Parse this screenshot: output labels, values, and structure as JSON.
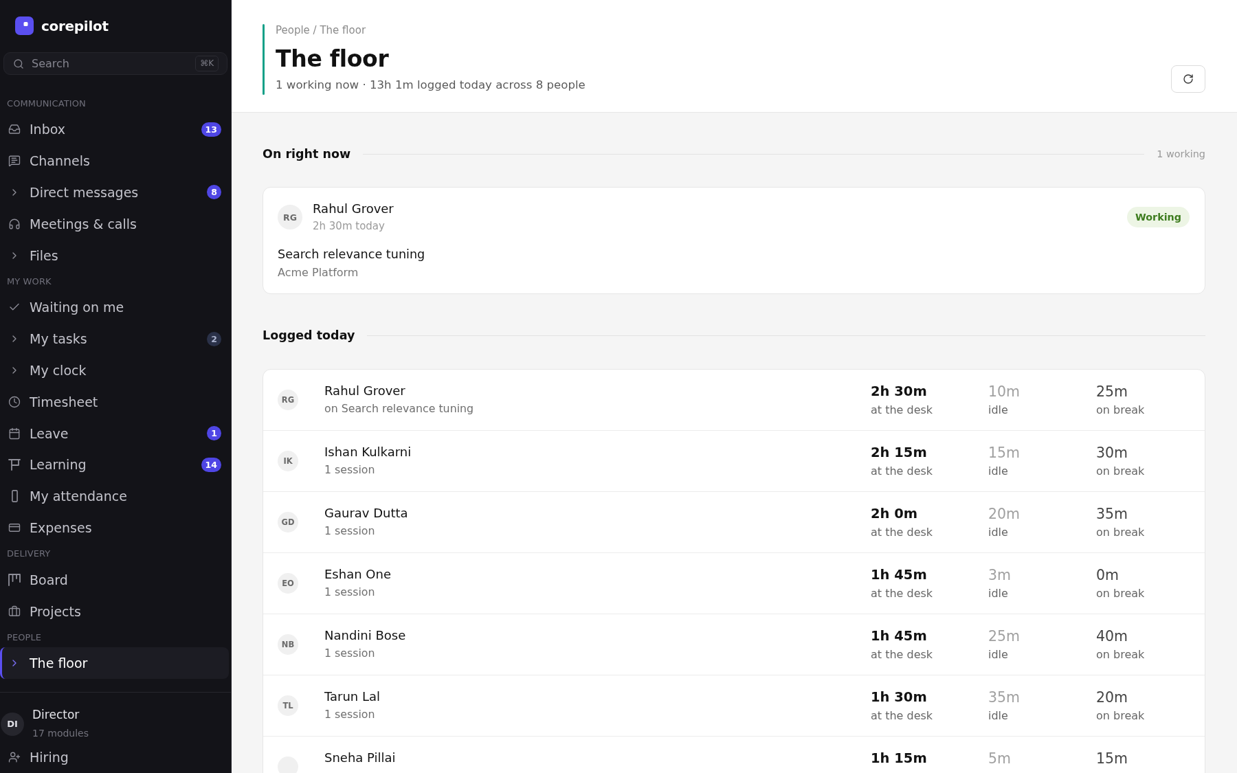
{
  "sidebar": {
    "brand": "corepilot",
    "search": {
      "placeholder": "Search",
      "shortcut": "⌘K"
    },
    "sections": [
      {
        "heading": "COMMUNICATION",
        "items": [
          {
            "label": "Inbox",
            "kind": "link",
            "selected": false,
            "badge": {
              "text": "13",
              "highlight": true
            }
          },
          {
            "label": "Channels",
            "kind": "link",
            "selected": false
          },
          {
            "label": "Direct messages",
            "kind": "group",
            "expanded": false,
            "selected": false,
            "badge": {
              "text": "8",
              "highlight": true
            }
          },
          {
            "label": "Meetings & calls",
            "kind": "link",
            "selected": false
          },
          {
            "label": "Files",
            "kind": "group",
            "expanded": false,
            "selected": false
          }
        ]
      },
      {
        "heading": "MY WORK",
        "items": [
          {
            "label": "Waiting on me",
            "kind": "link",
            "selected": false
          },
          {
            "label": "My tasks",
            "kind": "group",
            "expanded": false,
            "selected": false,
            "badge": {
              "text": "2",
              "highlight": false
            }
          },
          {
            "label": "My clock",
            "kind": "group",
            "expanded": false,
            "selected": false
          },
          {
            "label": "Timesheet",
            "kind": "link",
            "selected": false
          },
          {
            "label": "Leave",
            "kind": "link",
            "selected": false,
            "badge": {
              "text": "1",
              "highlight": true
            }
          },
          {
            "label": "Learning",
            "kind": "link",
            "selected": false,
            "badge": {
              "text": "14",
              "highlight": true
            }
          },
          {
            "label": "My attendance",
            "kind": "link",
            "selected": false
          },
          {
            "label": "Expenses",
            "kind": "link",
            "selected": false
          }
        ]
      },
      {
        "heading": "DELIVERY",
        "items": [
          {
            "label": "Board",
            "kind": "link",
            "selected": false
          },
          {
            "label": "Projects",
            "kind": "link",
            "selected": false
          }
        ]
      },
      {
        "heading": "PEOPLE",
        "items": [
          {
            "label": "The floor",
            "kind": "group",
            "expanded": false,
            "selected": true
          }
        ]
      }
    ],
    "user": {
      "initials": "DI",
      "name": "Director",
      "detail": "17 modules"
    },
    "footer_items": [
      {
        "label": "Hiring",
        "kind": "link",
        "selected": false
      }
    ]
  },
  "header": {
    "breadcrumb": "People / The floor",
    "title": "The floor",
    "subtitle": "1 working now · 13h 1m logged today across 8 people"
  },
  "on_right_now": {
    "heading": "On right now",
    "count": "1 working",
    "people": [
      {
        "initials": "RG",
        "name": "Rahul Grover",
        "time": "2h 30m today",
        "status": {
          "label": "Working",
          "kind": "working"
        },
        "task": "Search relevance tuning",
        "project": "Acme Platform"
      }
    ]
  },
  "logged_today": {
    "heading": "Logged today",
    "rows": [
      {
        "initials": "RG",
        "name": "Rahul Grover",
        "detail": "on Search relevance tuning",
        "times": [
          {
            "kind": "desk",
            "value": "2h 30m",
            "label": "at the desk"
          },
          {
            "kind": "idle",
            "value": "10m",
            "label": "idle"
          },
          {
            "kind": "break",
            "value": "25m",
            "label": "on break"
          }
        ]
      },
      {
        "initials": "IK",
        "name": "Ishan Kulkarni",
        "detail": "1 session",
        "times": [
          {
            "kind": "desk",
            "value": "2h 15m",
            "label": "at the desk"
          },
          {
            "kind": "idle",
            "value": "15m",
            "label": "idle"
          },
          {
            "kind": "break",
            "value": "30m",
            "label": "on break"
          }
        ]
      },
      {
        "initials": "GD",
        "name": "Gaurav Dutta",
        "detail": "1 session",
        "times": [
          {
            "kind": "desk",
            "value": "2h 0m",
            "label": "at the desk"
          },
          {
            "kind": "idle",
            "value": "20m",
            "label": "idle"
          },
          {
            "kind": "break",
            "value": "35m",
            "label": "on break"
          }
        ]
      },
      {
        "initials": "EO",
        "name": "Eshan One",
        "detail": "1 session",
        "times": [
          {
            "kind": "desk",
            "value": "1h 45m",
            "label": "at the desk"
          },
          {
            "kind": "idle",
            "value": "3m",
            "label": "idle"
          },
          {
            "kind": "break",
            "value": "0m",
            "label": "on break"
          }
        ]
      },
      {
        "initials": "NB",
        "name": "Nandini Bose",
        "detail": "1 session",
        "times": [
          {
            "kind": "desk",
            "value": "1h 45m",
            "label": "at the desk"
          },
          {
            "kind": "idle",
            "value": "25m",
            "label": "idle"
          },
          {
            "kind": "break",
            "value": "40m",
            "label": "on break"
          }
        ]
      },
      {
        "initials": "TL",
        "name": "Tarun Lal",
        "detail": "1 session",
        "times": [
          {
            "kind": "desk",
            "value": "1h 30m",
            "label": "at the desk"
          },
          {
            "kind": "idle",
            "value": "35m",
            "label": "idle"
          },
          {
            "kind": "break",
            "value": "20m",
            "label": "on break"
          }
        ]
      },
      {
        "name": "Sneha Pillai",
        "times": [
          {
            "kind": "desk",
            "value": "1h 15m"
          },
          {
            "kind": "idle",
            "value": "5m"
          },
          {
            "kind": "break",
            "value": "15m"
          }
        ]
      }
    ]
  }
}
